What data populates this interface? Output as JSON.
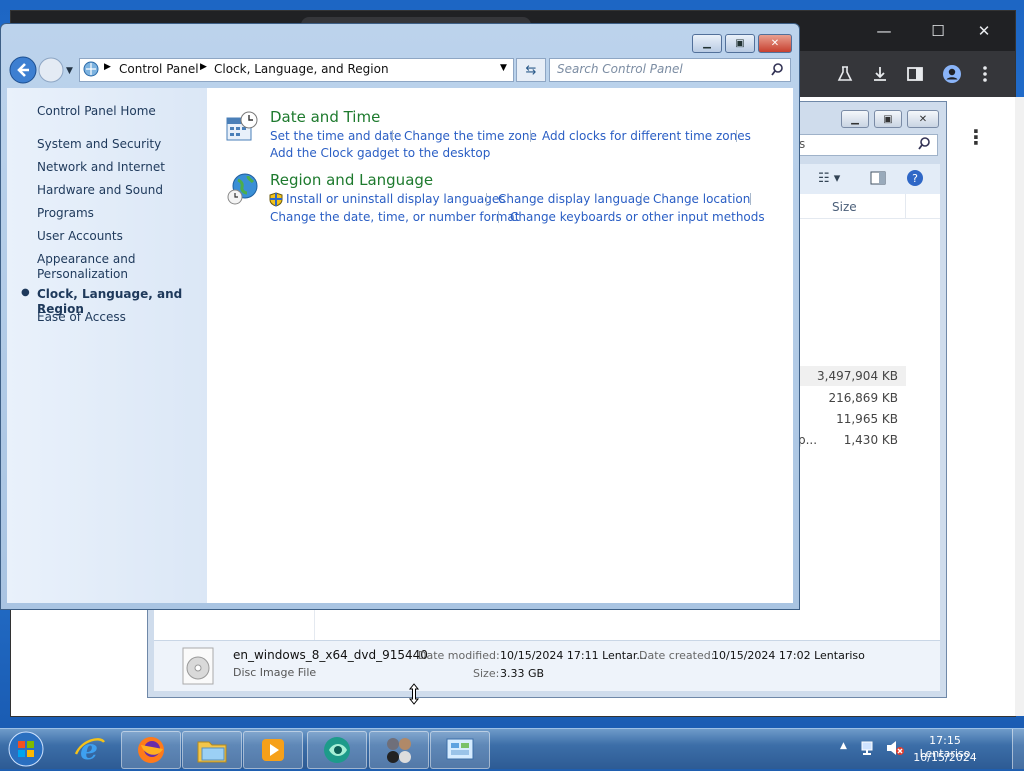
{
  "chrome": {
    "minimize": "—",
    "maximize": "☐",
    "close": "✕",
    "toolbar_icons": [
      "labs-icon",
      "download-icon",
      "sidebar-icon",
      "profile-icon",
      "menu-icon"
    ],
    "page_menu": "⋮"
  },
  "explorer": {
    "search_fragment": "s",
    "column_size": "Size",
    "sizes": [
      "3,497,904 KB",
      "216,869 KB",
      "11,965 KB",
      "1,430 KB"
    ],
    "row4_fragment": "p...",
    "details": {
      "file_name": "en_windows_8_x64_dvd_915440",
      "file_type": "Disc Image File",
      "modified_label": "Date modified:",
      "modified_value": "10/15/2024 17:11 Lentar...",
      "created_label": "Date created:",
      "created_value": "10/15/2024 17:02 Lentariso",
      "size_label": "Size:",
      "size_value": "3.33 GB"
    }
  },
  "control_panel": {
    "breadcrumb": [
      "Control Panel",
      "Clock, Language, and Region"
    ],
    "search_placeholder": "Search Control Panel",
    "nav": {
      "home": "Control Panel Home",
      "items": [
        "System and Security",
        "Network and Internet",
        "Hardware and Sound",
        "Programs",
        "User Accounts",
        "Appearance and Personalization",
        "Clock, Language, and Region",
        "Ease of Access"
      ],
      "active_index": 6
    },
    "categories": [
      {
        "title": "Date and Time",
        "links": [
          "Set the time and date",
          "Change the time zone",
          "Add clocks for different time zones",
          "Add the Clock gadget to the desktop"
        ]
      },
      {
        "title": "Region and Language",
        "links": [
          "Install or uninstall display languages",
          "Change display language",
          "Change location",
          "Change the date, time, or number format",
          "Change keyboards or other input methods"
        ]
      }
    ]
  },
  "taskbar": {
    "items": [
      "start-orb",
      "internet-explorer",
      "firefox",
      "windows-explorer",
      "media-player",
      "app-green",
      "app-people",
      "control-panel"
    ],
    "clock_time": "17:15 Lentariso",
    "clock_date": "10/15/2024"
  },
  "colors": {
    "link": "#2a5ec4",
    "category_title": "#1e7a2e",
    "nav_text": "#1e395b",
    "close_red": "#c7402f"
  }
}
